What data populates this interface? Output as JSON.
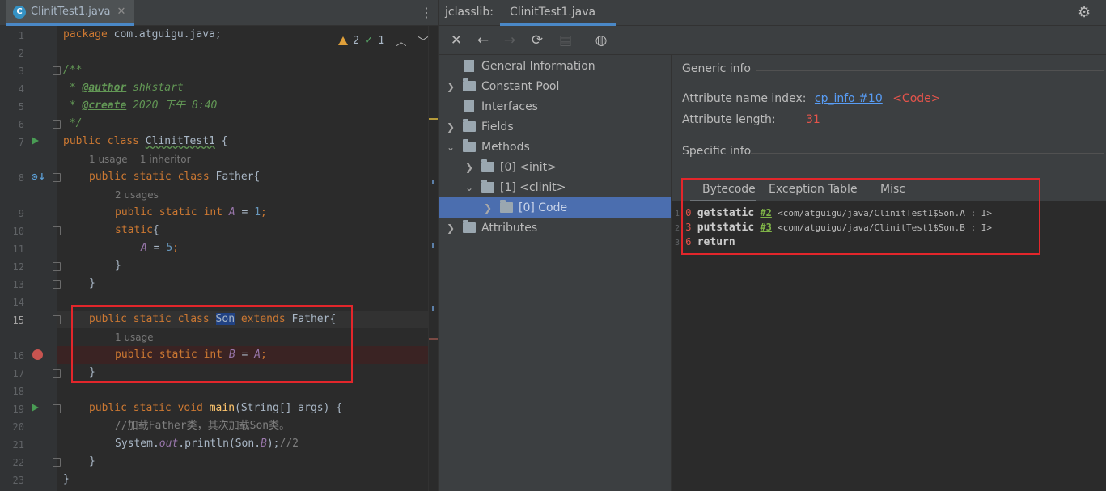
{
  "editor": {
    "tab": {
      "filename": "ClinitTest1.java",
      "icon": "class-c-icon",
      "close": "✕"
    },
    "inspections": {
      "warnings": "2",
      "typos": "1"
    },
    "line_numbers": [
      "1",
      "2",
      "3",
      "4",
      "5",
      "6",
      "7",
      "8",
      "9",
      "10",
      "11",
      "12",
      "13",
      "14",
      "15",
      "16",
      "17",
      "18",
      "19",
      "20",
      "21",
      "22",
      "23"
    ],
    "lines": {
      "l1": {
        "kw": "package",
        "rest": " com.atguigu.java;"
      },
      "l3": "/**",
      "l4": {
        "star": " * ",
        "tag": "@author",
        "text": " shkstart"
      },
      "l5": {
        "star": " * ",
        "tag": "@create",
        "text": " 2020 下午 8:40"
      },
      "l6": " */",
      "l7": {
        "kw": "public class ",
        "name": "ClinitTest1",
        "rest": " {"
      },
      "h7": "1 usage    1 inheritor",
      "l8": {
        "kw": "public static class ",
        "name": "Father{"
      },
      "h8": "2 usages",
      "l9": {
        "kw": "public static int ",
        "field": "A",
        "eq": " = ",
        "num": "1",
        "end": ";"
      },
      "l10": {
        "kw": "static",
        "rest": "{"
      },
      "l11": {
        "field": "A",
        "eq": " = ",
        "num": "5",
        "end": ";"
      },
      "l12": "}",
      "l13": "}",
      "l15": {
        "kw": "public static class ",
        "son": "Son",
        "kw2": " extends ",
        "rest": "Father{"
      },
      "h15": "1 usage",
      "l16": {
        "kw": "public static int ",
        "field": "B",
        "eq": " = ",
        "field2": "A",
        "end": ";"
      },
      "l17": "}",
      "l19": {
        "kw": "public static void ",
        "method": "main",
        "rest": "(String[] args) {"
      },
      "l20": "//加载Father类，其次加载Son类。",
      "l21": {
        "pre": "System.",
        "field": "out",
        "mid": ".println(Son.",
        "field2": "B",
        "end": ");",
        "comment": "//2"
      },
      "l22": "}",
      "l23": "}"
    }
  },
  "jclasslib": {
    "label": "jclasslib:",
    "tab": "ClinitTest1.java",
    "tree": {
      "general": "General Information",
      "constant_pool": "Constant Pool",
      "interfaces": "Interfaces",
      "fields": "Fields",
      "methods": "Methods",
      "init": "[0] <init>",
      "clinit": "[1] <clinit>",
      "code": "[0] Code",
      "attributes": "Attributes"
    },
    "detail": {
      "generic_title": "Generic info",
      "attr_name_label": "Attribute name index:",
      "attr_name_link": "cp_info #10",
      "attr_name_value": "<Code>",
      "attr_length_label": "Attribute length:",
      "attr_length_value": "31",
      "specific_title": "Specific info",
      "tabs": [
        "Bytecode",
        "Exception Table",
        "Misc"
      ]
    },
    "bytecode": [
      {
        "n": "1",
        "off": "0",
        "op": "getstatic",
        "ref": "#2",
        "comment": "<com/atguigu/java/ClinitTest1$Son.A : I>"
      },
      {
        "n": "2",
        "off": "3",
        "op": "putstatic",
        "ref": "#3",
        "comment": "<com/atguigu/java/ClinitTest1$Son.B : I>"
      },
      {
        "n": "3",
        "off": "6",
        "op": "return",
        "ref": "",
        "comment": ""
      }
    ]
  }
}
